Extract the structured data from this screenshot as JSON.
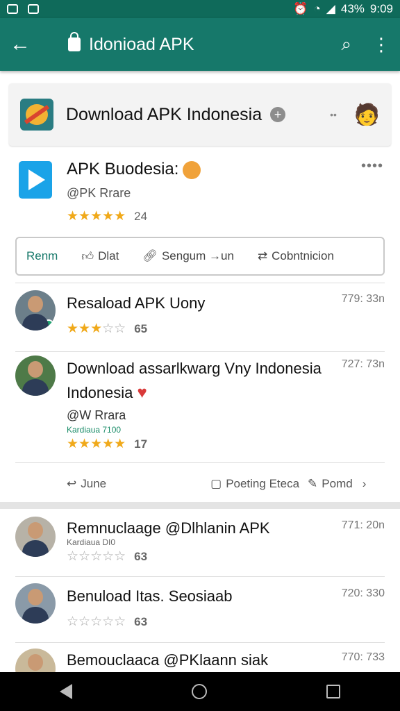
{
  "status_bar": {
    "battery": "43%",
    "time": "9:09"
  },
  "app_bar": {
    "title": "Idonioad APK"
  },
  "header_card": {
    "title": "Download APK Indonesia"
  },
  "app": {
    "name": "APK Buodesia:",
    "developer": "@PK Rrare",
    "stars": "★★★★★",
    "rating_value": 4.5,
    "rating_count": "24"
  },
  "actions": [
    {
      "label": "Renm",
      "icon": "none"
    },
    {
      "label": "Dlat",
      "icon": "thumb-up-icon"
    },
    {
      "label": "Sengum →un",
      "icon": "link-icon"
    },
    {
      "label": "Cobntnicion",
      "icon": "sync-icon"
    }
  ],
  "reviews": [
    {
      "name": "Resaload APK Uony",
      "time": "779: 33n",
      "stars_on": "★★★",
      "stars_off": "☆☆",
      "count": "65"
    },
    {
      "name_line1": "Download assarlkwarg Vny Indonesia",
      "name_line2": "Indonesia",
      "time": "727: 73n",
      "sub": "@W Rrara",
      "small": "Kardiaua 7100",
      "stars_on": "★★★★★",
      "stars_off": "",
      "count": "17"
    },
    {
      "name": "Remnuclaage @Dlhlanin APK",
      "time": "771: 20n",
      "small": "Kardiaua DI0",
      "stars_on": "",
      "stars_off": "☆☆☆☆☆",
      "count": "63"
    },
    {
      "name": "Benuload Itas. Seosiaab",
      "time": "720: 330",
      "stars_on": "",
      "stars_off": "☆☆☆☆☆",
      "count": "63"
    },
    {
      "name": "Bemouclaaca @PKlaann siak",
      "time": "770: 733"
    }
  ],
  "reply_bar": {
    "reply": "June",
    "posting": "Poeting Eteca",
    "pomd": "Pomd"
  }
}
